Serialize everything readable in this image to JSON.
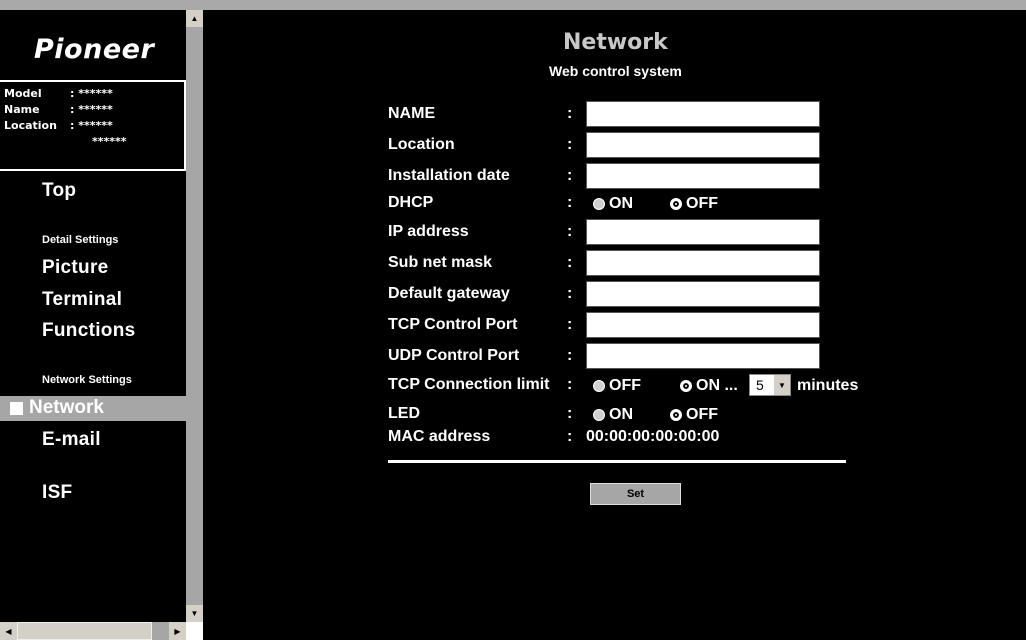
{
  "sidebar": {
    "logo": "Pioneer",
    "info": {
      "model_label": "Model",
      "model_value": ": ******",
      "name_label": "Name",
      "name_value": ": ******",
      "location_label": "Location",
      "location_value": ": ******",
      "location_value2": "******"
    },
    "nav": {
      "top": "Top",
      "detail_section": "Detail Settings",
      "picture": "Picture",
      "terminal": "Terminal",
      "functions": "Functions",
      "network_section": "Network Settings",
      "network": "Network",
      "email": "E-mail",
      "isf": "ISF"
    },
    "selected": "Network"
  },
  "main": {
    "title": "Network",
    "subtitle": "Web control system",
    "colon": ":",
    "fields": {
      "name_label": "NAME",
      "location_label": "Location",
      "install_label": "Installation date",
      "dhcp_label": "DHCP",
      "ip_label": "IP address",
      "subnet_label": "Sub net mask",
      "gateway_label": "Default gateway",
      "tcp_port_label": "TCP Control Port",
      "udp_port_label": "UDP Control Port",
      "tcp_limit_label": "TCP Connection limit",
      "led_label": "LED",
      "mac_label": "MAC address"
    },
    "values": {
      "name": "",
      "location": "",
      "install_date": "",
      "ip": "",
      "subnet": "",
      "gateway": "",
      "tcp_port": "",
      "udp_port": "",
      "mac": "00:00:00:00:00:00"
    },
    "dhcp": {
      "on": "ON",
      "off": "OFF",
      "selected": "OFF"
    },
    "tcp_limit": {
      "off": "OFF",
      "on": "ON ...",
      "selected": "ON",
      "minutes_value": "5",
      "minutes_label": "minutes"
    },
    "led": {
      "on": "ON",
      "off": "OFF",
      "selected": "OFF"
    },
    "set_button": "Set"
  },
  "icons": [
    "scroll-up-arrow-icon",
    "scroll-down-arrow-icon",
    "scroll-left-arrow-icon",
    "scroll-right-arrow-icon",
    "dropdown-arrow-icon",
    "selected-square-icon"
  ]
}
